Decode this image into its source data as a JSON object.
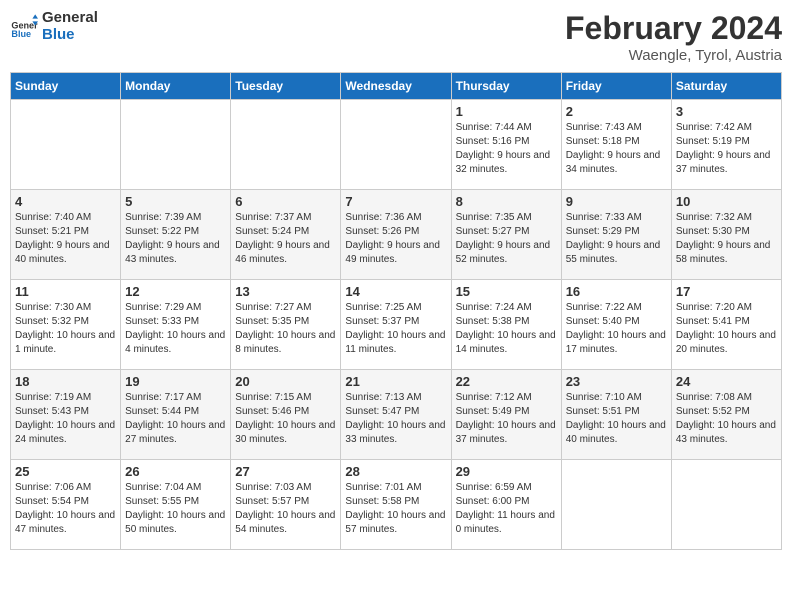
{
  "logo": {
    "line1": "General",
    "line2": "Blue"
  },
  "title": "February 2024",
  "location": "Waengle, Tyrol, Austria",
  "days_of_week": [
    "Sunday",
    "Monday",
    "Tuesday",
    "Wednesday",
    "Thursday",
    "Friday",
    "Saturday"
  ],
  "weeks": [
    [
      {
        "day": "",
        "info": ""
      },
      {
        "day": "",
        "info": ""
      },
      {
        "day": "",
        "info": ""
      },
      {
        "day": "",
        "info": ""
      },
      {
        "day": "1",
        "sunrise": "7:44 AM",
        "sunset": "5:16 PM",
        "daylight": "9 hours and 32 minutes."
      },
      {
        "day": "2",
        "sunrise": "7:43 AM",
        "sunset": "5:18 PM",
        "daylight": "9 hours and 34 minutes."
      },
      {
        "day": "3",
        "sunrise": "7:42 AM",
        "sunset": "5:19 PM",
        "daylight": "9 hours and 37 minutes."
      }
    ],
    [
      {
        "day": "4",
        "sunrise": "7:40 AM",
        "sunset": "5:21 PM",
        "daylight": "9 hours and 40 minutes."
      },
      {
        "day": "5",
        "sunrise": "7:39 AM",
        "sunset": "5:22 PM",
        "daylight": "9 hours and 43 minutes."
      },
      {
        "day": "6",
        "sunrise": "7:37 AM",
        "sunset": "5:24 PM",
        "daylight": "9 hours and 46 minutes."
      },
      {
        "day": "7",
        "sunrise": "7:36 AM",
        "sunset": "5:26 PM",
        "daylight": "9 hours and 49 minutes."
      },
      {
        "day": "8",
        "sunrise": "7:35 AM",
        "sunset": "5:27 PM",
        "daylight": "9 hours and 52 minutes."
      },
      {
        "day": "9",
        "sunrise": "7:33 AM",
        "sunset": "5:29 PM",
        "daylight": "9 hours and 55 minutes."
      },
      {
        "day": "10",
        "sunrise": "7:32 AM",
        "sunset": "5:30 PM",
        "daylight": "9 hours and 58 minutes."
      }
    ],
    [
      {
        "day": "11",
        "sunrise": "7:30 AM",
        "sunset": "5:32 PM",
        "daylight": "10 hours and 1 minute."
      },
      {
        "day": "12",
        "sunrise": "7:29 AM",
        "sunset": "5:33 PM",
        "daylight": "10 hours and 4 minutes."
      },
      {
        "day": "13",
        "sunrise": "7:27 AM",
        "sunset": "5:35 PM",
        "daylight": "10 hours and 8 minutes."
      },
      {
        "day": "14",
        "sunrise": "7:25 AM",
        "sunset": "5:37 PM",
        "daylight": "10 hours and 11 minutes."
      },
      {
        "day": "15",
        "sunrise": "7:24 AM",
        "sunset": "5:38 PM",
        "daylight": "10 hours and 14 minutes."
      },
      {
        "day": "16",
        "sunrise": "7:22 AM",
        "sunset": "5:40 PM",
        "daylight": "10 hours and 17 minutes."
      },
      {
        "day": "17",
        "sunrise": "7:20 AM",
        "sunset": "5:41 PM",
        "daylight": "10 hours and 20 minutes."
      }
    ],
    [
      {
        "day": "18",
        "sunrise": "7:19 AM",
        "sunset": "5:43 PM",
        "daylight": "10 hours and 24 minutes."
      },
      {
        "day": "19",
        "sunrise": "7:17 AM",
        "sunset": "5:44 PM",
        "daylight": "10 hours and 27 minutes."
      },
      {
        "day": "20",
        "sunrise": "7:15 AM",
        "sunset": "5:46 PM",
        "daylight": "10 hours and 30 minutes."
      },
      {
        "day": "21",
        "sunrise": "7:13 AM",
        "sunset": "5:47 PM",
        "daylight": "10 hours and 33 minutes."
      },
      {
        "day": "22",
        "sunrise": "7:12 AM",
        "sunset": "5:49 PM",
        "daylight": "10 hours and 37 minutes."
      },
      {
        "day": "23",
        "sunrise": "7:10 AM",
        "sunset": "5:51 PM",
        "daylight": "10 hours and 40 minutes."
      },
      {
        "day": "24",
        "sunrise": "7:08 AM",
        "sunset": "5:52 PM",
        "daylight": "10 hours and 43 minutes."
      }
    ],
    [
      {
        "day": "25",
        "sunrise": "7:06 AM",
        "sunset": "5:54 PM",
        "daylight": "10 hours and 47 minutes."
      },
      {
        "day": "26",
        "sunrise": "7:04 AM",
        "sunset": "5:55 PM",
        "daylight": "10 hours and 50 minutes."
      },
      {
        "day": "27",
        "sunrise": "7:03 AM",
        "sunset": "5:57 PM",
        "daylight": "10 hours and 54 minutes."
      },
      {
        "day": "28",
        "sunrise": "7:01 AM",
        "sunset": "5:58 PM",
        "daylight": "10 hours and 57 minutes."
      },
      {
        "day": "29",
        "sunrise": "6:59 AM",
        "sunset": "6:00 PM",
        "daylight": "11 hours and 0 minutes."
      },
      {
        "day": "",
        "info": ""
      },
      {
        "day": "",
        "info": ""
      }
    ]
  ]
}
